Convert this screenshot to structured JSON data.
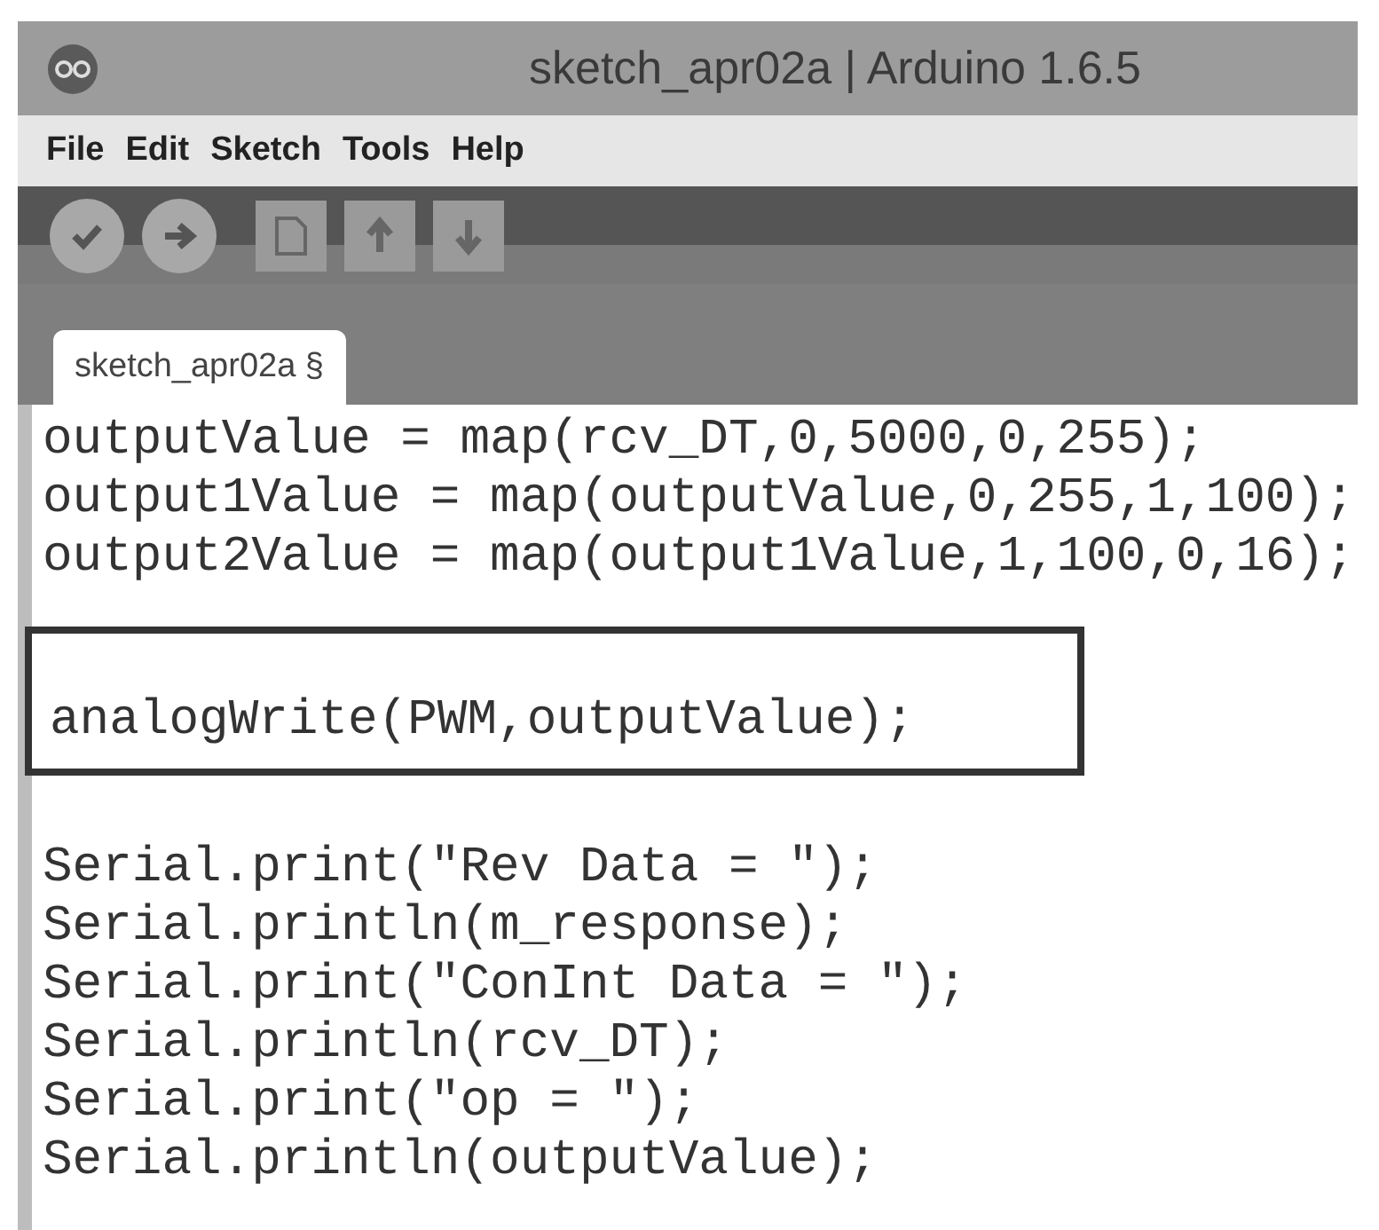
{
  "window": {
    "title": "sketch_apr02a | Arduino 1.6.5"
  },
  "menu": [
    "File",
    "Edit",
    "Sketch",
    "Tools",
    "Help"
  ],
  "toolbar": [
    {
      "kind": "verify"
    },
    {
      "kind": "upload"
    },
    {
      "kind": "new"
    },
    {
      "kind": "open"
    },
    {
      "kind": "save"
    }
  ],
  "tabs": [
    {
      "label": "sketch_apr02a §",
      "selected": true
    }
  ],
  "code": [
    {
      "boxed": false,
      "lines": [
        "outputValue = map(rcv_DT,0,5000,0,255);",
        "output1Value = map(outputValue,0,255,1,100);",
        "output2Value = map(output1Value,1,100,0,16);"
      ]
    },
    {
      "boxed": true,
      "lines": [
        "analogWrite(PWM,outputValue);"
      ]
    },
    {
      "boxed": false,
      "lines": [
        "Serial.print(\"Rev Data = \");",
        "Serial.println(m_response);",
        "Serial.print(\"ConInt Data = \");",
        "Serial.println(rcv_DT);",
        "Serial.print(\"op = \");",
        "Serial.println(outputValue);"
      ]
    }
  ]
}
